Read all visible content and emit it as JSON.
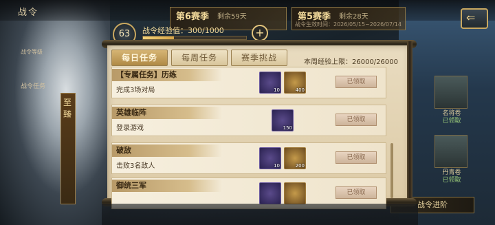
{
  "header": {
    "title": "战令"
  },
  "seasons": [
    {
      "name": "第6赛季",
      "remain": "剩余59天"
    },
    {
      "name": "第5赛季",
      "remain": "剩余28天",
      "period": "战令生效时间：2026/05/15~2026/07/14"
    }
  ],
  "level": {
    "value": "63",
    "exp_label": "战令经验值：300/1000",
    "exp_fraction": 0.3
  },
  "tabs": [
    {
      "label": "每日任务",
      "active": true
    },
    {
      "label": "每周任务",
      "active": false
    },
    {
      "label": "赛季挑战",
      "active": false
    }
  ],
  "weekly_limit": "本周经验上限：26000/26000",
  "tasks": [
    {
      "title": "【专属任务】历练",
      "desc": "完成3场对局",
      "rewards": [
        {
          "qty": "10",
          "kind": "purple"
        },
        {
          "qty": "400",
          "kind": "gold"
        }
      ],
      "button": "已领取"
    },
    {
      "title": "英雄临阵",
      "desc": "登录游戏",
      "rewards": [
        {
          "qty": "150",
          "kind": "purple"
        }
      ],
      "button": "已领取"
    },
    {
      "title": "破敌",
      "desc": "击败3名敌人",
      "rewards": [
        {
          "qty": "10",
          "kind": "purple"
        },
        {
          "qty": "200",
          "kind": "gold"
        }
      ],
      "button": "已领取"
    },
    {
      "title": "御统三军",
      "desc": "",
      "rewards": [
        {
          "qty": "",
          "kind": "purple"
        },
        {
          "qty": "",
          "kind": "gold"
        }
      ],
      "button": "已领取"
    }
  ],
  "side": {
    "tag": "至臻",
    "task_label": "战令任务",
    "level_tag": "战令等级"
  },
  "right_items": [
    {
      "label": "名将卷",
      "status": "已领取"
    },
    {
      "label": "丹青卷",
      "status": "已领取"
    }
  ],
  "advance_button": "战令进阶",
  "colors": {
    "accent_gold": "#c9a860",
    "panel": "#e9dcc0",
    "claim": "#cdb49a"
  }
}
